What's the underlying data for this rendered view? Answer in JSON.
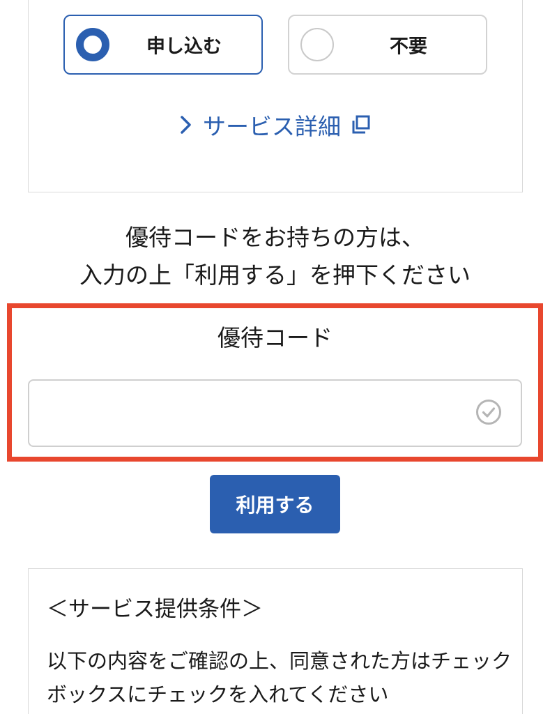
{
  "service_options": {
    "apply_label": "申し込む",
    "none_label": "不要",
    "selected": "apply",
    "detail_link_label": "サービス詳細"
  },
  "instruction": {
    "line1": "優待コードをお持ちの方は、",
    "line2": "入力の上「利用する」を押下ください"
  },
  "coupon": {
    "title": "優待コード",
    "value": "",
    "placeholder": ""
  },
  "use_button_label": "利用する",
  "conditions": {
    "title": "＜サービス提供条件＞",
    "body": "以下の内容をご確認の上、同意された方はチェックボックスにチェックを入れてください"
  },
  "colors": {
    "accent": "#2b5fb0",
    "highlight": "#e8472e",
    "border": "#d9d9d9"
  },
  "icons": {
    "detail_chevron": "chevron-right-icon",
    "external": "external-window-icon",
    "input_check": "check-circle-icon"
  }
}
